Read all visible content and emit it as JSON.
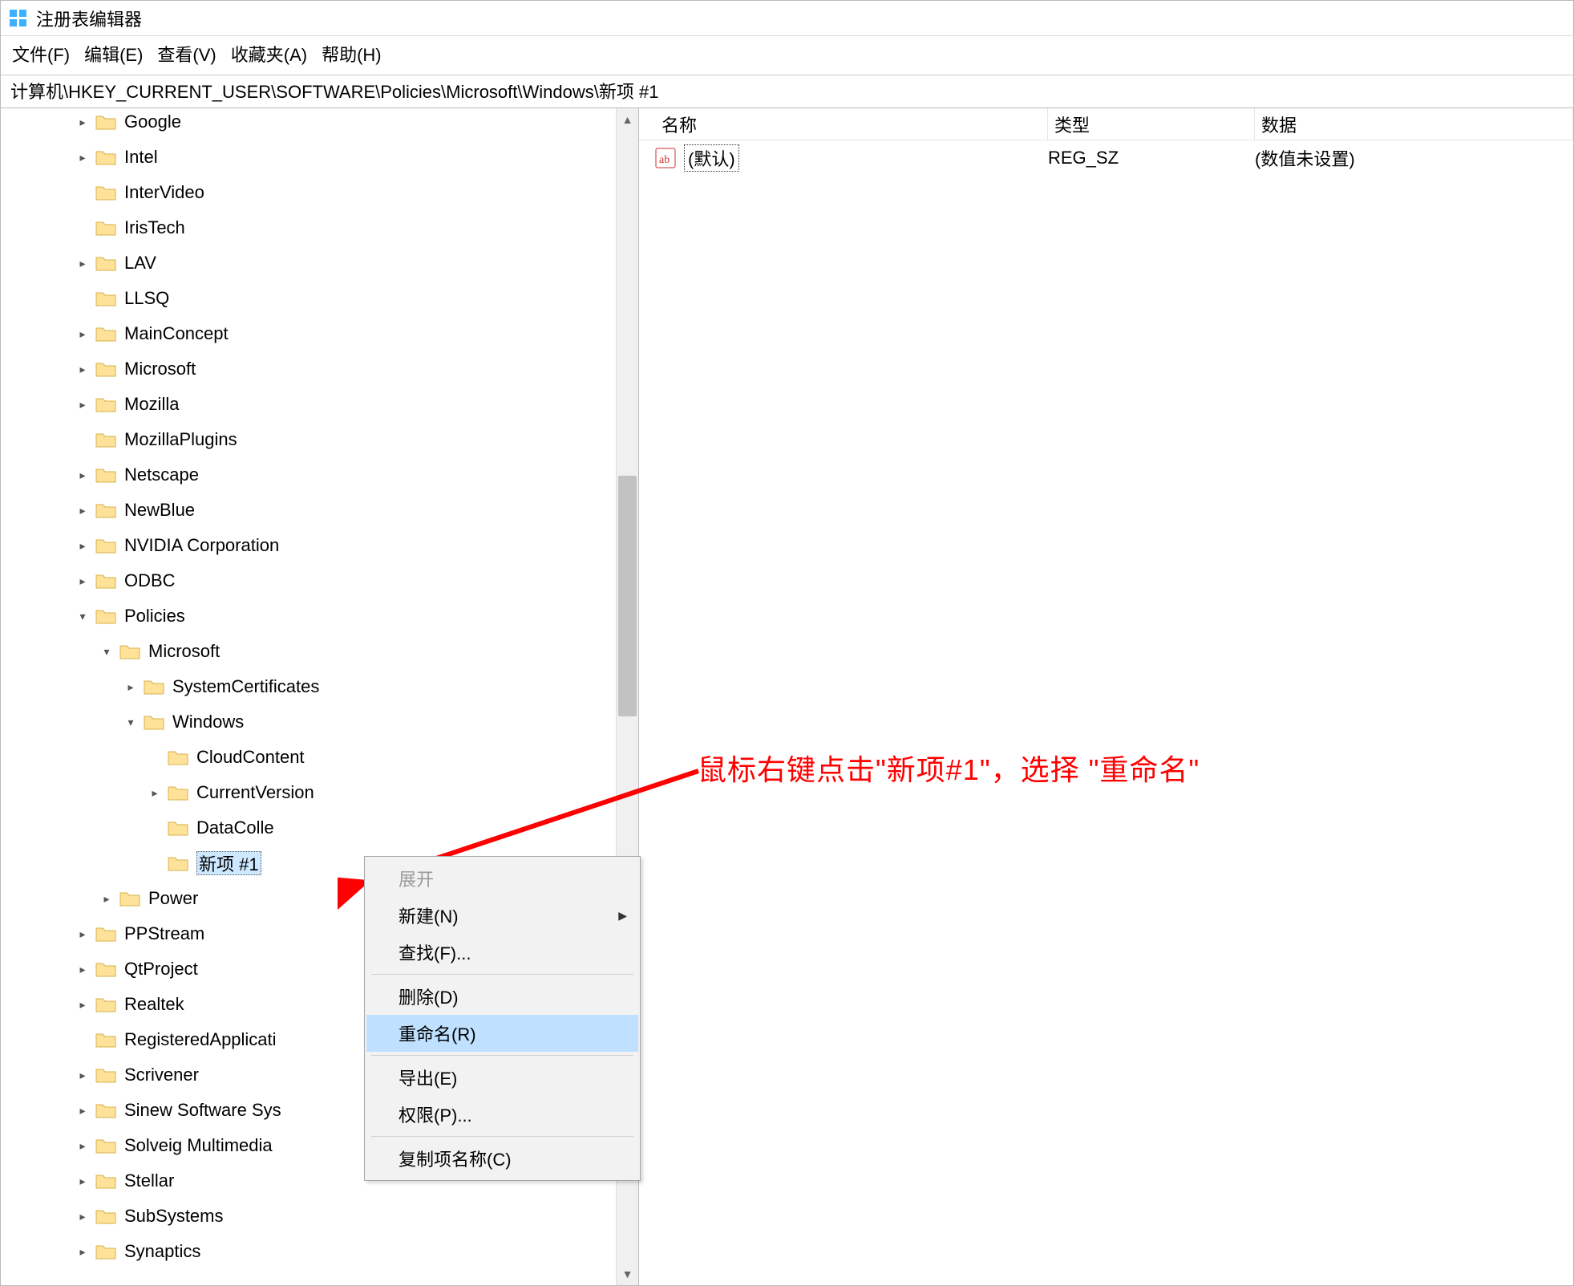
{
  "title": "注册表编辑器",
  "menu": {
    "file": "文件(F)",
    "edit": "编辑(E)",
    "view": "查看(V)",
    "fav": "收藏夹(A)",
    "help": "帮助(H)"
  },
  "address": "计算机\\HKEY_CURRENT_USER\\SOFTWARE\\Policies\\Microsoft\\Windows\\新项 #1",
  "tree": [
    {
      "d": 3,
      "exp": ">",
      "label": "Google"
    },
    {
      "d": 3,
      "exp": ">",
      "label": "Intel"
    },
    {
      "d": 3,
      "exp": "",
      "label": "InterVideo"
    },
    {
      "d": 3,
      "exp": "",
      "label": "IrisTech"
    },
    {
      "d": 3,
      "exp": ">",
      "label": "LAV"
    },
    {
      "d": 3,
      "exp": "",
      "label": "LLSQ"
    },
    {
      "d": 3,
      "exp": ">",
      "label": "MainConcept"
    },
    {
      "d": 3,
      "exp": ">",
      "label": "Microsoft"
    },
    {
      "d": 3,
      "exp": ">",
      "label": "Mozilla"
    },
    {
      "d": 3,
      "exp": "",
      "label": "MozillaPlugins"
    },
    {
      "d": 3,
      "exp": ">",
      "label": "Netscape"
    },
    {
      "d": 3,
      "exp": ">",
      "label": "NewBlue"
    },
    {
      "d": 3,
      "exp": ">",
      "label": "NVIDIA Corporation"
    },
    {
      "d": 3,
      "exp": ">",
      "label": "ODBC"
    },
    {
      "d": 3,
      "exp": "v",
      "label": "Policies"
    },
    {
      "d": 4,
      "exp": "v",
      "label": "Microsoft"
    },
    {
      "d": 5,
      "exp": ">",
      "label": "SystemCertificates"
    },
    {
      "d": 5,
      "exp": "v",
      "label": "Windows"
    },
    {
      "d": 6,
      "exp": "",
      "label": "CloudContent"
    },
    {
      "d": 6,
      "exp": ">",
      "label": "CurrentVersion"
    },
    {
      "d": 6,
      "exp": "",
      "label": "DataColle"
    },
    {
      "d": 6,
      "exp": "",
      "label": "新项 #1",
      "selected": true
    },
    {
      "d": 4,
      "exp": ">",
      "label": "Power"
    },
    {
      "d": 3,
      "exp": ">",
      "label": "PPStream"
    },
    {
      "d": 3,
      "exp": ">",
      "label": "QtProject"
    },
    {
      "d": 3,
      "exp": ">",
      "label": "Realtek"
    },
    {
      "d": 3,
      "exp": "",
      "label": "RegisteredApplicati"
    },
    {
      "d": 3,
      "exp": ">",
      "label": "Scrivener"
    },
    {
      "d": 3,
      "exp": ">",
      "label": "Sinew Software Sys"
    },
    {
      "d": 3,
      "exp": ">",
      "label": "Solveig Multimedia"
    },
    {
      "d": 3,
      "exp": ">",
      "label": "Stellar"
    },
    {
      "d": 3,
      "exp": ">",
      "label": "SubSystems"
    },
    {
      "d": 3,
      "exp": ">",
      "label": "Synaptics"
    }
  ],
  "columns": {
    "name": "名称",
    "type": "类型",
    "data": "数据"
  },
  "values": [
    {
      "name": "(默认)",
      "type": "REG_SZ",
      "data": "(数值未设置)"
    }
  ],
  "context_menu": [
    {
      "label": "展开",
      "disabled": true
    },
    {
      "label": "新建(N)",
      "sub": true
    },
    {
      "label": "查找(F)..."
    },
    {
      "sep": true
    },
    {
      "label": "删除(D)"
    },
    {
      "label": "重命名(R)",
      "hover": true
    },
    {
      "sep": true
    },
    {
      "label": "导出(E)"
    },
    {
      "label": "权限(P)..."
    },
    {
      "sep": true
    },
    {
      "label": "复制项名称(C)"
    }
  ],
  "annotation": "鼠标右键点击\"新项#1\"，选择 \"重命名\""
}
